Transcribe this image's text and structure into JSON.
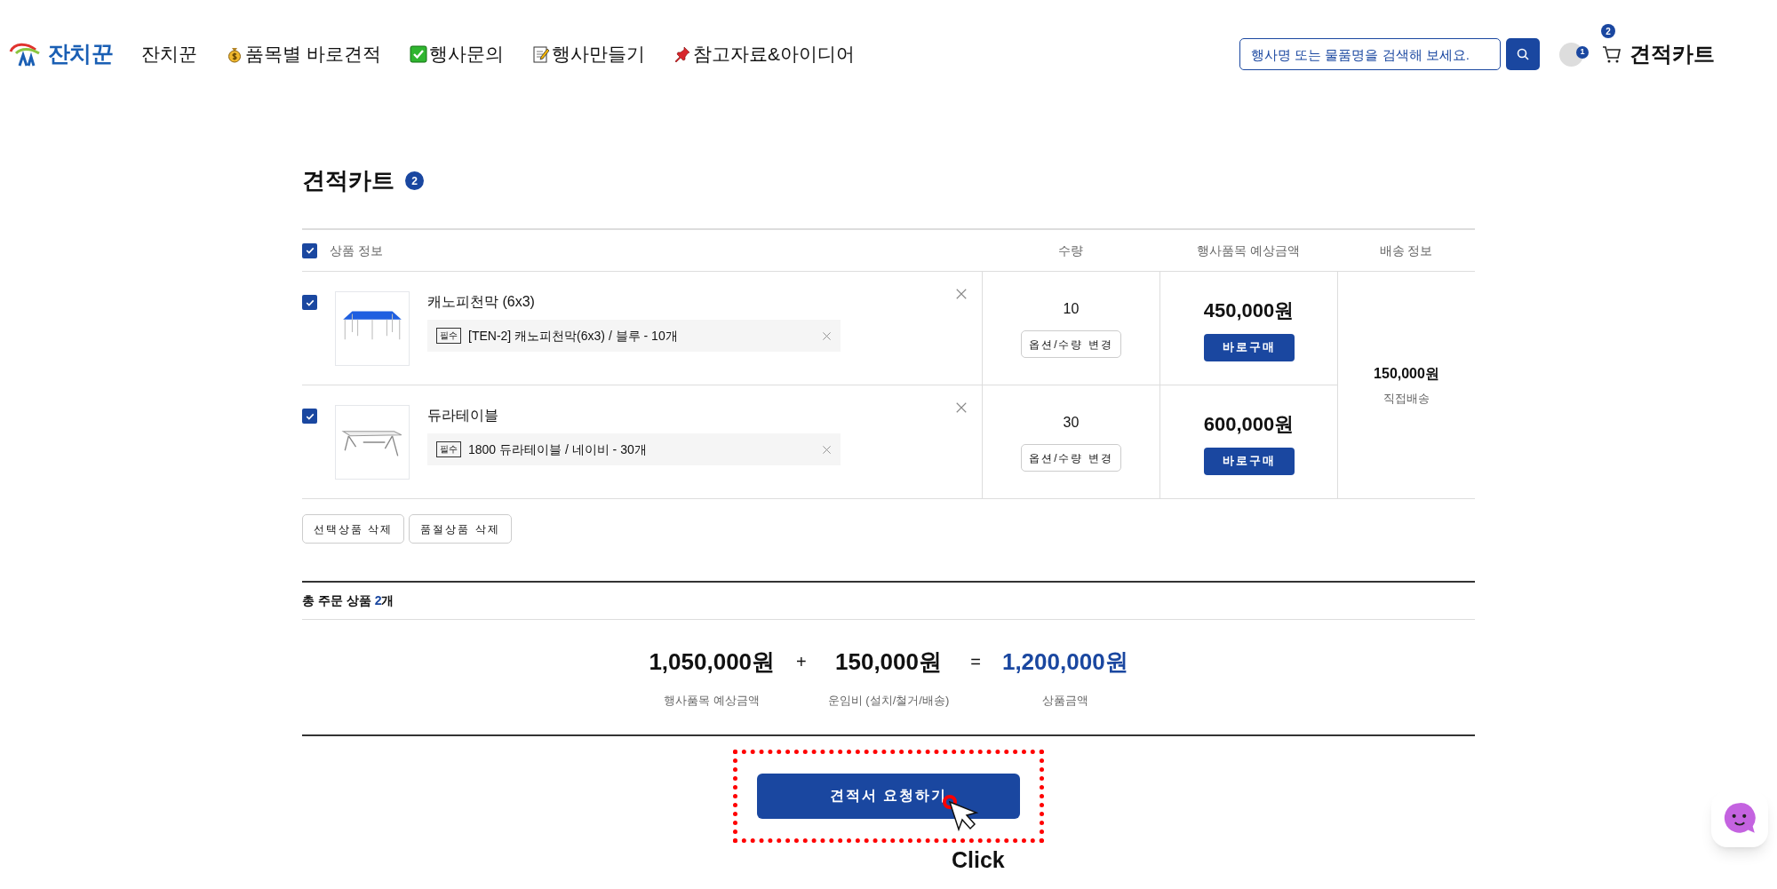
{
  "header": {
    "logo_text": "잔치꾼",
    "nav": [
      {
        "label": "잔치꾼"
      },
      {
        "label": "품목별 바로견적"
      },
      {
        "label": "행사문의"
      },
      {
        "label": "행사만들기"
      },
      {
        "label": "참고자료&아이디어"
      }
    ],
    "search": {
      "placeholder": "행사명 또는 물품명을 검색해 보세요."
    },
    "user_badge": "1",
    "cart_badge": "2",
    "cart_label": "견적카트"
  },
  "page": {
    "title": "견적카트",
    "count": "2"
  },
  "table": {
    "select_all": {
      "checked": true
    },
    "columns": [
      "상품 정보",
      "수량",
      "행사품목 예상금액",
      "배송 정보"
    ],
    "rows": [
      {
        "checked": true,
        "name": "캐노피천막 (6x3)",
        "option_tag": "필수",
        "option": "[TEN-2] 캐노피천막(6x3) / 블루 - 10개",
        "quantity": "10",
        "change_button": "옵션/수량 변경",
        "price": "450,000원",
        "buy_button": "바로구매"
      },
      {
        "checked": true,
        "name": "듀라테이블",
        "option_tag": "필수",
        "option": "1800 듀라테이블 / 네이비 - 30개",
        "quantity": "30",
        "change_button": "옵션/수량 변경",
        "price": "600,000원",
        "buy_button": "바로구매"
      }
    ],
    "delivery": {
      "fee": "150,000원",
      "method": "직접배송"
    }
  },
  "actions": [
    "선택상품 삭제",
    "품절상품 삭제"
  ],
  "summary": {
    "label": "총 주문 상품 ",
    "count": "2",
    "unit": "개",
    "terms": [
      {
        "amount": "1,050,000원",
        "caption": "행사품목 예상금액",
        "highlight": false
      },
      {
        "amount": "150,000원",
        "caption": "운임비 (설치/철거/배송)",
        "highlight": false
      },
      {
        "amount": "1,200,000원",
        "caption": "상품금액",
        "highlight": true
      }
    ],
    "operators": [
      "+",
      "="
    ]
  },
  "submit_button": "견적서 요청하기",
  "annotation": {
    "label": "Click"
  }
}
